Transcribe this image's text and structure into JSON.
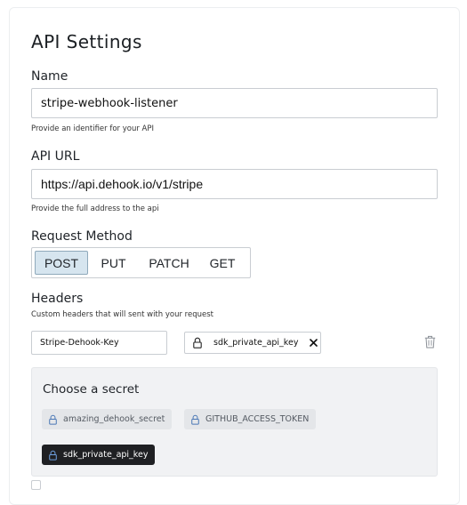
{
  "page": {
    "title": "API Settings"
  },
  "name_field": {
    "label": "Name",
    "value": "stripe-webhook-listener",
    "help": "Provide an identifier for your API"
  },
  "url_field": {
    "label": "API URL",
    "value": "https://api.dehook.io/v1/stripe",
    "help": "Provide the full address to the api"
  },
  "method": {
    "label": "Request Method",
    "options": [
      "POST",
      "PUT",
      "PATCH",
      "GET"
    ],
    "selected": "POST"
  },
  "headers": {
    "label": "Headers",
    "help": "Custom headers that will sent with your request",
    "items": [
      {
        "key": "Stripe-Dehook-Key",
        "value": "sdk_private_api_key",
        "value_icon": "lock-icon",
        "clear_icon": "close-icon",
        "delete_icon": "trash-icon"
      }
    ]
  },
  "secret_picker": {
    "title": "Choose a secret",
    "secrets": [
      {
        "name": "amazing_dehook_secret",
        "icon": "lock-icon",
        "selected": false
      },
      {
        "name": "GITHUB_ACCESS_TOKEN",
        "icon": "lock-icon",
        "selected": false
      },
      {
        "name": "sdk_private_api_key",
        "icon": "lock-icon",
        "selected": true
      }
    ]
  },
  "colors": {
    "selected_method_bg": "#d6e5ef",
    "selected_secret_bg": "#1f2023",
    "panel_bg": "#f1f2f4",
    "input_border": "#c9cdd2"
  }
}
